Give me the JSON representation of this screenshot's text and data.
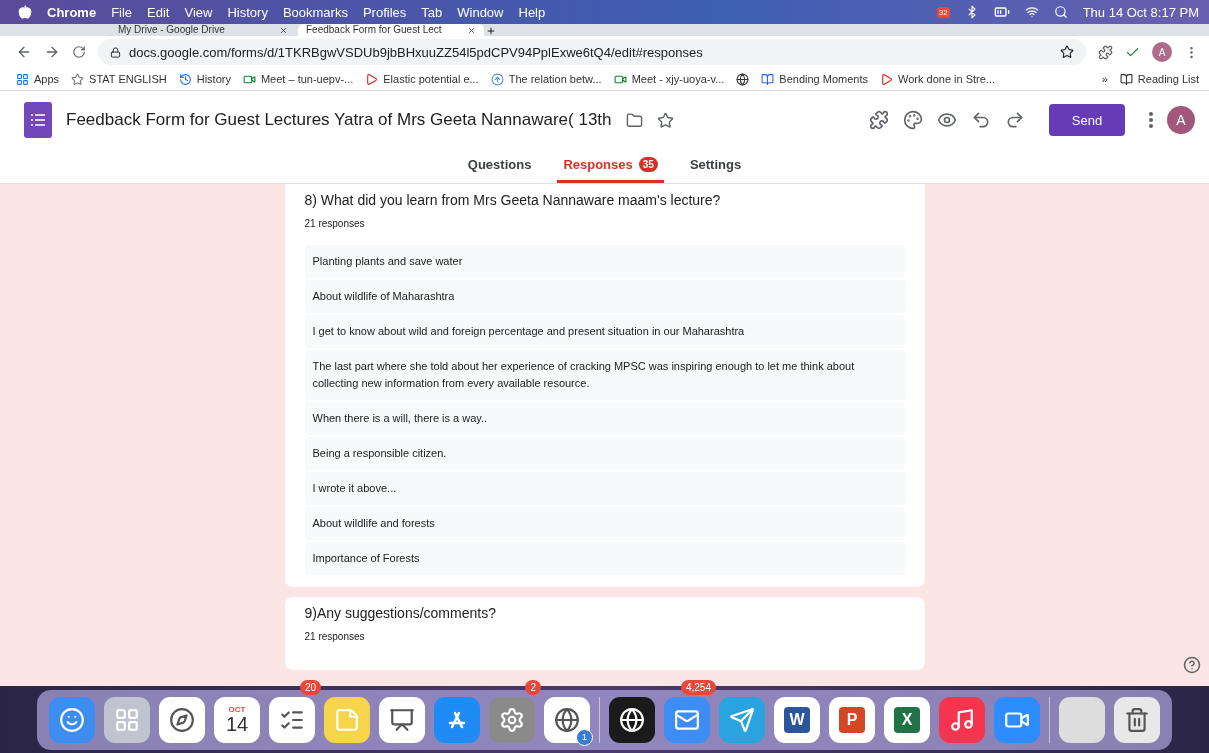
{
  "menubar": {
    "app": "Chrome",
    "menus": [
      "File",
      "Edit",
      "View",
      "History",
      "Bookmarks",
      "Profiles",
      "Tab",
      "Window",
      "Help"
    ],
    "calendar_badge": "32",
    "clock": "Thu 14 Oct 8:17 PM"
  },
  "browser_tabs": [
    {
      "title": "My Drive - Google Drive",
      "selected": false
    },
    {
      "title": "Feedback Form for Guest Lect",
      "selected": true
    }
  ],
  "address_bar": {
    "url": "docs.google.com/forms/d/1TKRBgwVSDUb9jbBHxuuZZ54l5pdCPV94PplExwe6tQ4/edit#responses",
    "profile": "A"
  },
  "bookmarks": [
    {
      "label": "Apps",
      "kind": "apps"
    },
    {
      "label": "STAT ENGLISH",
      "kind": "site"
    },
    {
      "label": "History",
      "kind": "history"
    },
    {
      "label": "Meet – tun-uepv-...",
      "kind": "meet"
    },
    {
      "label": "Elastic potential e...",
      "kind": "video"
    },
    {
      "label": "The relation betw...",
      "kind": "upload"
    },
    {
      "label": "Meet - xjy-uoya-v...",
      "kind": "meet"
    },
    {
      "kind": "globe"
    },
    {
      "label": "Bending Moments",
      "kind": "edu"
    },
    {
      "label": "Work done in Stre...",
      "kind": "video"
    }
  ],
  "bookmarks_overflow": "»",
  "reading_list": "Reading List",
  "form": {
    "title": "Feedback Form for Guest Lectures Yatra  of Mrs Geeta Nannaware( 13th",
    "send": "Send",
    "avatar": "A",
    "tabs": [
      {
        "label": "Questions",
        "selected": false
      },
      {
        "label": "Responses",
        "selected": true,
        "badge": "35"
      },
      {
        "label": "Settings",
        "selected": false
      }
    ]
  },
  "questions": [
    {
      "title": "8) What did you learn from Mrs Geeta Nannaware maam's lecture?",
      "count": "21 responses",
      "responses": [
        "Planting plants and save water",
        "About wildlife of Maharashtra",
        "I get to know about wild and foreign percentage and present situation in our Maharashtra",
        "The last part where she told about her experience of cracking MPSC was inspiring enough to let me think about collecting new information from every available resource.",
        "When there is a will, there is a way..",
        "Being a responsible citizen.",
        "I wrote it above...",
        "About wildlife and forests",
        "Importance of Forests"
      ]
    },
    {
      "title": "9)Any suggestions/comments?",
      "count": "21 responses"
    }
  ],
  "dock": [
    {
      "kind": "finder"
    },
    {
      "kind": "launchpad"
    },
    {
      "kind": "photos"
    },
    {
      "kind": "calendar",
      "month": "OCT",
      "day": "14"
    },
    {
      "kind": "reminders",
      "badge": "20"
    },
    {
      "kind": "notes"
    },
    {
      "kind": "keynote"
    },
    {
      "kind": "appstore"
    },
    {
      "kind": "settings",
      "badge": "2"
    },
    {
      "kind": "chrome",
      "sub": "1"
    },
    {
      "kind": "separator"
    },
    {
      "kind": "webex"
    },
    {
      "kind": "mail",
      "badge": "4,254"
    },
    {
      "kind": "telegram"
    },
    {
      "kind": "office",
      "letter": "W",
      "color": "#2b579a"
    },
    {
      "kind": "office",
      "letter": "P",
      "color": "#d24726"
    },
    {
      "kind": "office",
      "letter": "X",
      "color": "#217346"
    },
    {
      "kind": "music"
    },
    {
      "kind": "zoom"
    },
    {
      "kind": "separator"
    },
    {
      "kind": "screenshot"
    },
    {
      "kind": "trash"
    }
  ]
}
